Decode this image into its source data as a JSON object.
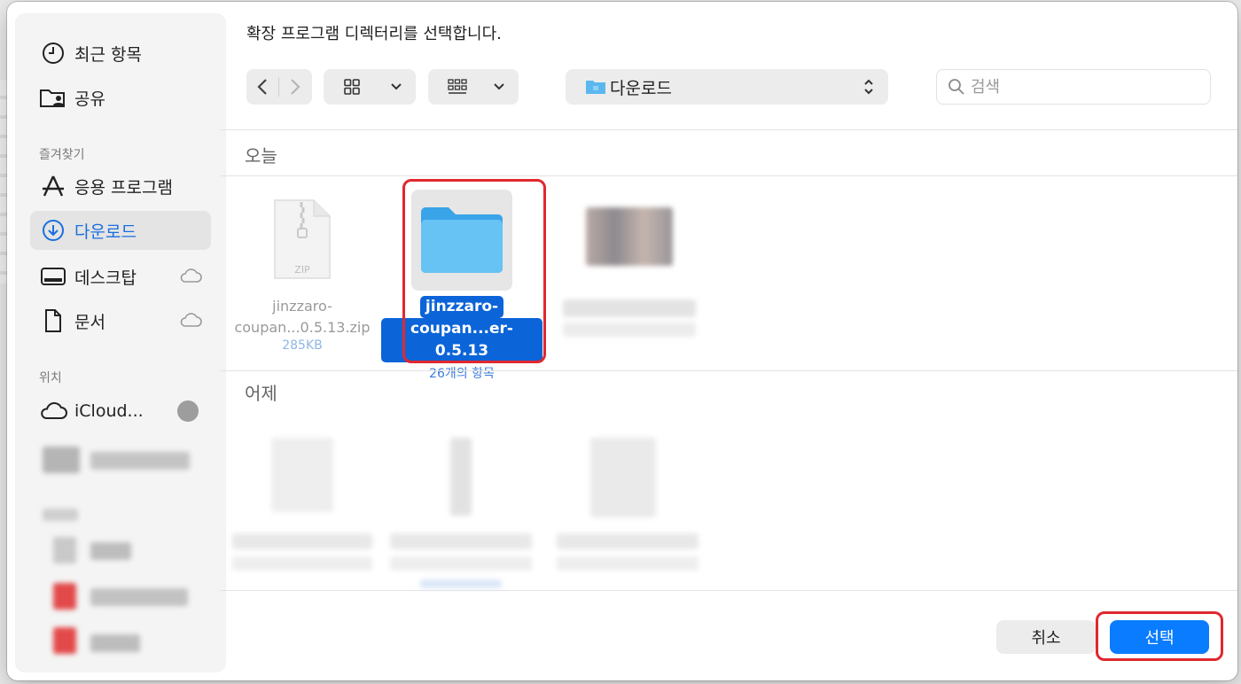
{
  "dialog": {
    "title": "확장 프로그램 디렉터리를 선택합니다.",
    "current_path": "다운로드",
    "search_placeholder": "검색",
    "cancel_label": "취소",
    "confirm_label": "선택"
  },
  "sidebar": {
    "recent": "최근 항목",
    "shared": "공유",
    "favorites_header": "즐겨찾기",
    "apps": "응용 프로그램",
    "downloads": "다운로드",
    "desktop": "데스크탑",
    "documents": "문서",
    "locations_header": "위치",
    "icloud": "iCloud..."
  },
  "groups": {
    "today": "오늘",
    "yesterday": "어제"
  },
  "files": {
    "zip": {
      "name_line1": "jinzzaro-",
      "name_line2": "coupan...0.5.13.zip",
      "size": "285KB",
      "badge": "ZIP"
    },
    "folder": {
      "name_line1": "jinzzaro-",
      "name_line2": "coupan...er-0.5.13",
      "count": "26개의 항목"
    }
  },
  "colors": {
    "accent": "#0a7cff",
    "highlight": "#e0282e",
    "folder": "#5ab8ef"
  }
}
